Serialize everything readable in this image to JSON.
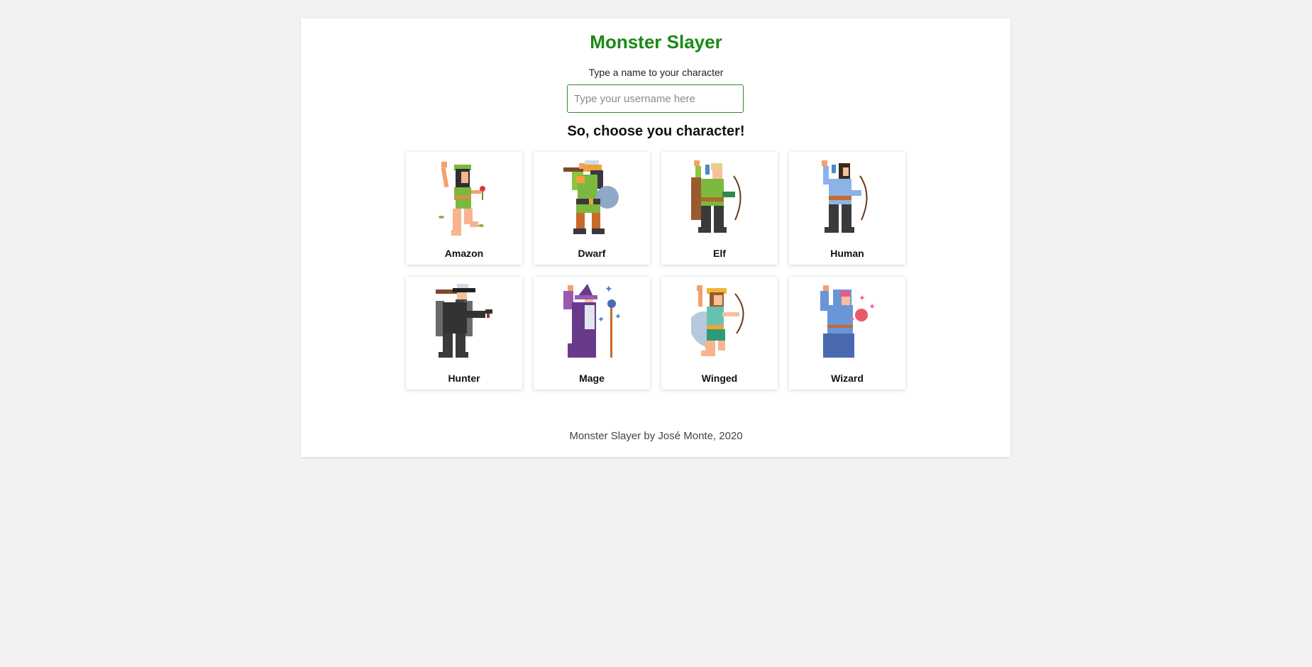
{
  "header": {
    "title": "Monster Slayer"
  },
  "form": {
    "prompt": "Type a name to your character",
    "placeholder": "Type your username here",
    "value": ""
  },
  "selection": {
    "heading": "So, choose you character!"
  },
  "characters": [
    {
      "label": "Amazon",
      "icon": "amazon-icon"
    },
    {
      "label": "Dwarf",
      "icon": "dwarf-icon"
    },
    {
      "label": "Elf",
      "icon": "elf-icon"
    },
    {
      "label": "Human",
      "icon": "human-icon"
    },
    {
      "label": "Hunter",
      "icon": "hunter-icon"
    },
    {
      "label": "Mage",
      "icon": "mage-icon"
    },
    {
      "label": "Winged",
      "icon": "winged-icon"
    },
    {
      "label": "Wizard",
      "icon": "wizard-icon"
    }
  ],
  "footer": {
    "text": "Monster Slayer by José Monte, 2020"
  },
  "colors": {
    "accent": "#1a8a17",
    "background": "#f2f2f2",
    "panel": "#ffffff"
  }
}
